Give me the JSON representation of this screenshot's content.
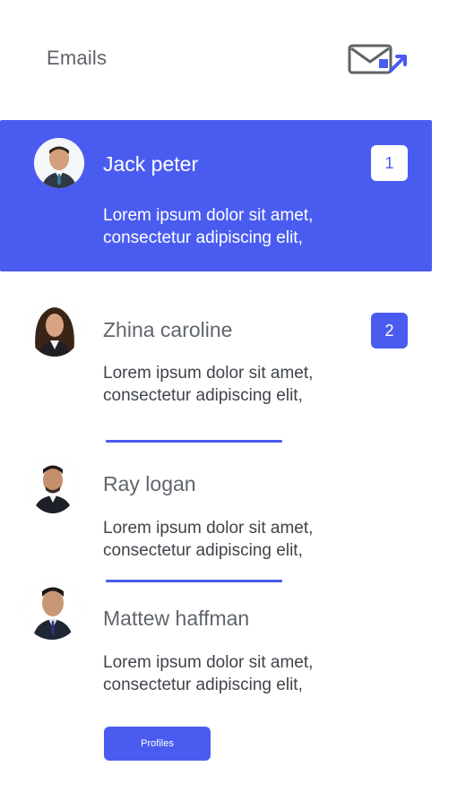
{
  "header": {
    "title": "Emails",
    "icon": "mail-send-icon",
    "accent_color": "#4a5cf0"
  },
  "emails": [
    {
      "name": "Jack peter",
      "snippet": "Lorem ipsum dolor sit amet, consectetur adipiscing elit,",
      "badge": "1",
      "active": true
    },
    {
      "name": "Zhina caroline",
      "snippet": "Lorem ipsum dolor sit amet, consectetur adipiscing elit,",
      "badge": "2",
      "active": false
    },
    {
      "name": "Ray logan",
      "snippet": "Lorem ipsum dolor sit amet, consectetur adipiscing elit,",
      "active": false
    },
    {
      "name": "Mattew haffman",
      "snippet": "Lorem ipsum dolor sit amet, consectetur adipiscing elit,",
      "active": false
    }
  ],
  "footer": {
    "profiles_label": "Profiles"
  },
  "colors": {
    "primary": "#4a5cf0",
    "text": "#5f6368"
  }
}
